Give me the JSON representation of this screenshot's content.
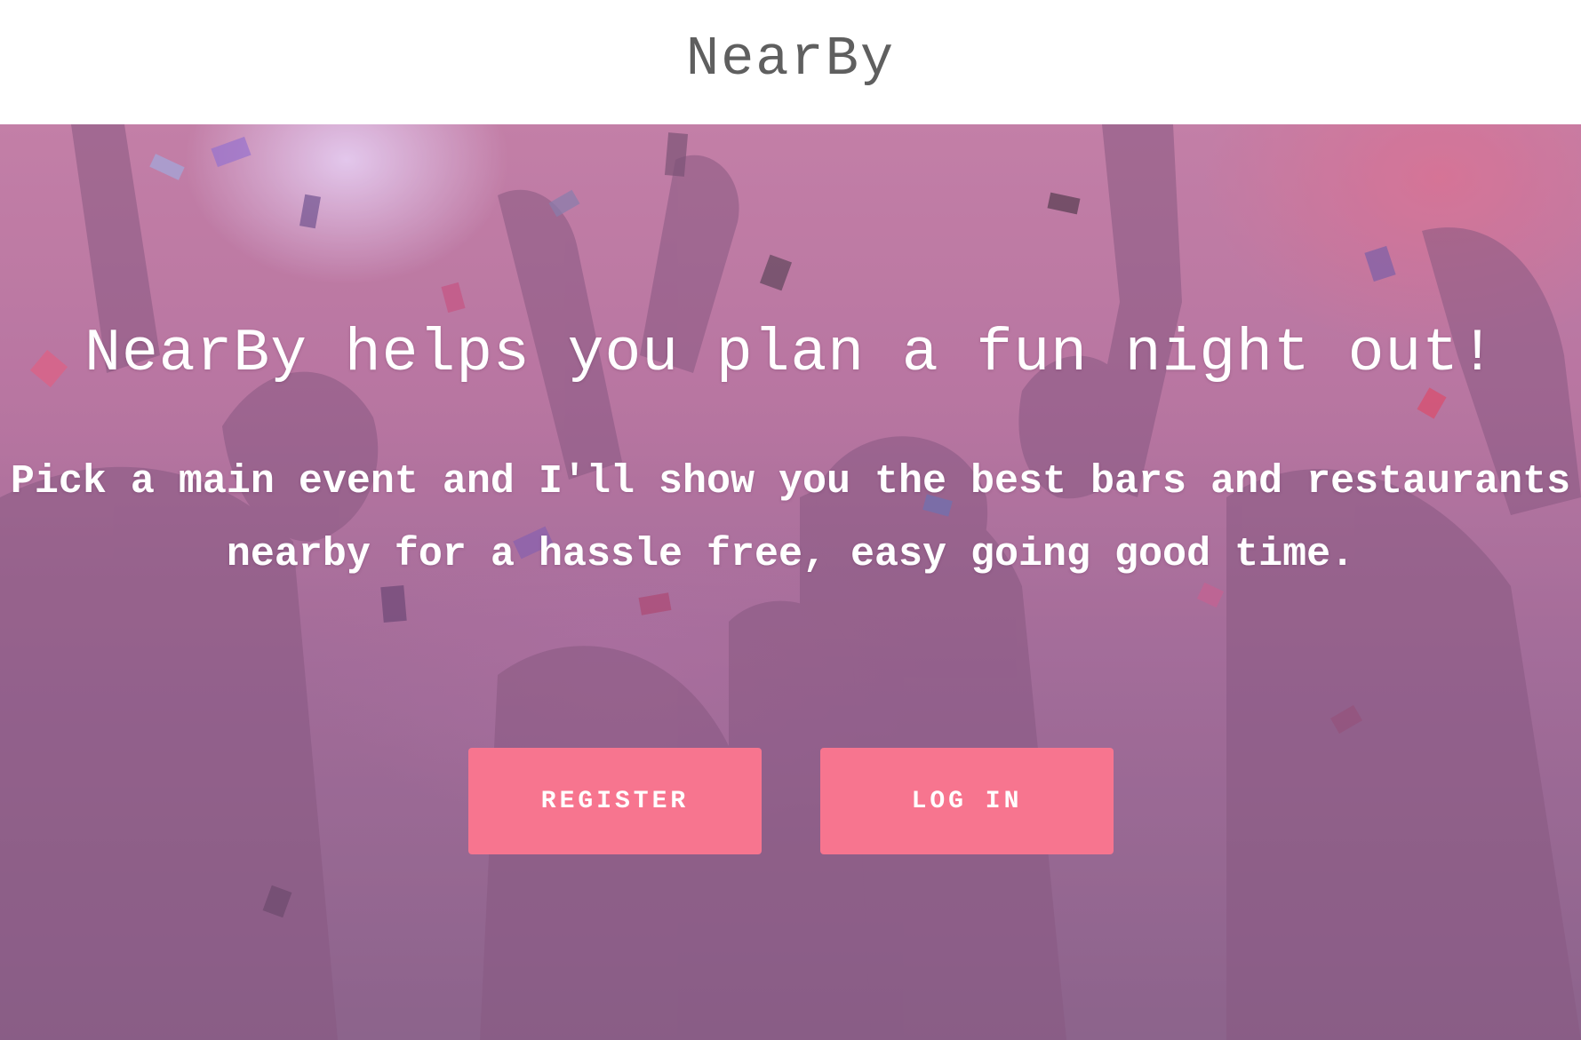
{
  "header": {
    "brand": "NearBy"
  },
  "hero": {
    "headline": "NearBy helps you plan a fun night out!",
    "subtext": "Pick a main event and I'll show you the best bars and restaurants nearby for a hassle free, easy going good time.",
    "background_description_icon": "party-crowd-image",
    "buttons": {
      "register_label": "REGISTER",
      "login_label": "LOG IN"
    }
  },
  "colors": {
    "brand_text": "#5f5f5f",
    "button_bg": "#f7758f",
    "button_text": "#ffffff",
    "hero_text": "#ffffff"
  }
}
